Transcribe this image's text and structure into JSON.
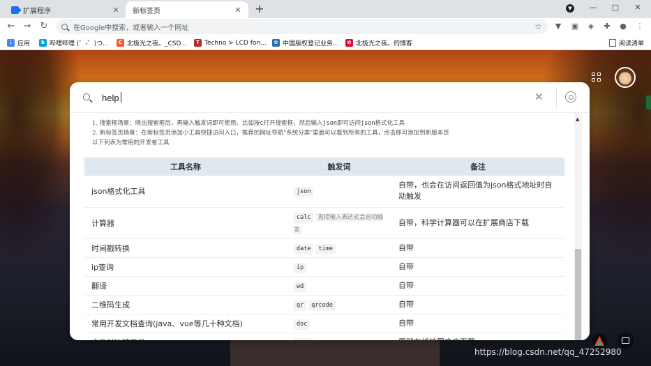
{
  "browser": {
    "tabs": [
      {
        "title": "扩展程序",
        "icon": "puzzle-icon",
        "active": false
      },
      {
        "title": "新标签页",
        "icon": "none",
        "active": true
      }
    ],
    "new_tab_label": "+",
    "window_controls": {
      "profile": "▼",
      "minimize": "—",
      "maximize": "□",
      "close": "✕"
    },
    "nav": {
      "back": "←",
      "forward": "→",
      "reload": "↻",
      "home": "⌂"
    },
    "omnibox_placeholder": "在Google中搜索，或者输入一个网址",
    "star": "☆"
  },
  "bookmarks": [
    {
      "label": "应用",
      "icon": "apps-grid-icon",
      "color": "#4285f4"
    },
    {
      "label": "哔哩哔哩 (゜-゜)つ...",
      "icon": "bilibili-icon",
      "color": "#00a1d6"
    },
    {
      "label": "北极光之夜。_CSD...",
      "icon": "csdn-icon",
      "color": "#fc5531"
    },
    {
      "label": "Techno > LCD fon...",
      "icon": "techno-icon",
      "color": "#b5282d"
    },
    {
      "label": "中国版权登记业务...",
      "icon": "copyright-icon",
      "color": "#2b6cb0"
    },
    {
      "label": "北极光之夜。的博客",
      "icon": "huawei-icon",
      "color": "#e40a2d"
    }
  ],
  "reading_list": "阅读清单",
  "search": {
    "value": "help",
    "clear_icon": "✕"
  },
  "help_text": {
    "line1_a": "1. 搜索框场景：唤出搜索框后，再输入触发词即可使用。比如按",
    "line1_key": "c",
    "line1_b": "打开搜索框，然后输入",
    "line1_code1": "json",
    "line1_c": "即可访问",
    "line1_code2": "json",
    "line1_d": "格式化工具",
    "line2": "2. 新标签页场景：在新标签页添加小工具快捷访问入口，推荐的网址导航\"系统分类\"里面可以看到所有的工具，点击即可添加到新版本页",
    "line3": "以下列表为常用的开发者工具"
  },
  "table": {
    "headers": [
      "工具名称",
      "触发词",
      "备注"
    ],
    "rows": [
      {
        "name": "json格式化工具",
        "triggers": [
          "json"
        ],
        "note": "自带，也会在访问返回值为json格式地址时自动触发"
      },
      {
        "name": "计算器",
        "triggers": [
          "calc"
        ],
        "extra": "直接输入表达式会自动触发",
        "note": "自带，科学计算器可以在扩展商店下载"
      },
      {
        "name": "时间戳转换",
        "triggers": [
          "date",
          "time"
        ],
        "note": "自带"
      },
      {
        "name": "ip查询",
        "triggers": [
          "ip"
        ],
        "note": "自带"
      },
      {
        "name": "翻译",
        "triggers": [
          "wd"
        ],
        "note": "自带"
      },
      {
        "name": "二维码生成",
        "triggers": [
          "qr",
          "qrcode"
        ],
        "note": "自带"
      },
      {
        "name": "常用开发文档查询(java、vue等几十种文档)",
        "triggers": [
          "doc"
        ],
        "note": "自带"
      },
      {
        "name": "文件对比转工具",
        "triggers": [
          "text"
        ],
        "note": "需到在线扩展商店下载"
      }
    ]
  },
  "watermark": "https://blog.csdn.net/qq_47252980"
}
